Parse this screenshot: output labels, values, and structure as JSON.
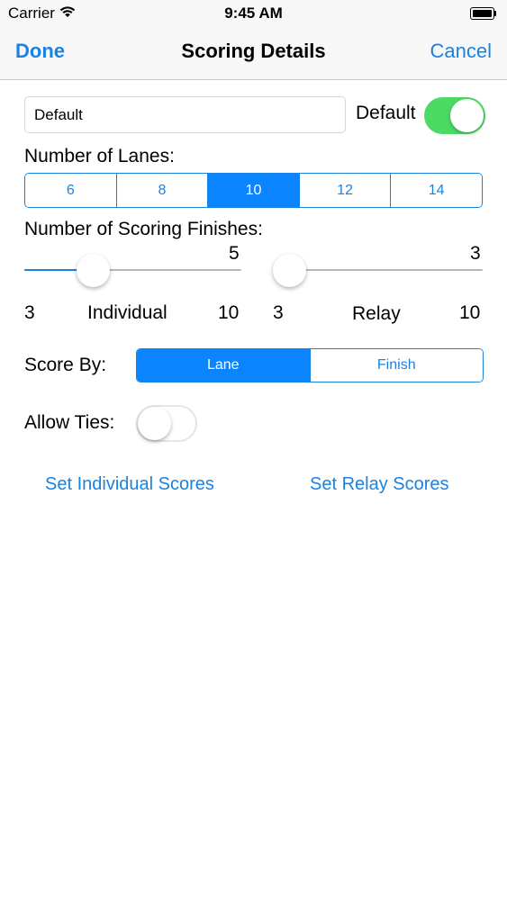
{
  "status_bar": {
    "carrier": "Carrier",
    "time": "9:45 AM",
    "wifi_icon": "wifi-icon",
    "battery_icon": "battery-icon",
    "battery_level": 1.0
  },
  "nav": {
    "left": "Done",
    "title": "Scoring Details",
    "right": "Cancel"
  },
  "name_field": {
    "value": "Default",
    "placeholder": ""
  },
  "default_toggle": {
    "label": "Default",
    "on": true
  },
  "lanes": {
    "label": "Number of Lanes:",
    "options": [
      "6",
      "8",
      "10",
      "12",
      "14"
    ],
    "selected": "10"
  },
  "finishes": {
    "label": "Number of Scoring Finishes:",
    "individual": {
      "value": "5",
      "min": "3",
      "max": "10",
      "label": "Individual"
    },
    "relay": {
      "value": "3",
      "min": "3",
      "max": "10",
      "label": "Relay"
    }
  },
  "score_by": {
    "label": "Score By:",
    "options": [
      "Lane",
      "Finish"
    ],
    "selected": "Lane"
  },
  "allow_ties": {
    "label": "Allow Ties:",
    "on": false
  },
  "links": {
    "individual": "Set Individual Scores",
    "relay": "Set Relay Scores"
  },
  "colors": {
    "accent": "#1a82e0",
    "toggle_on": "#4cd964",
    "bar_bg": "#f7f7f7"
  }
}
